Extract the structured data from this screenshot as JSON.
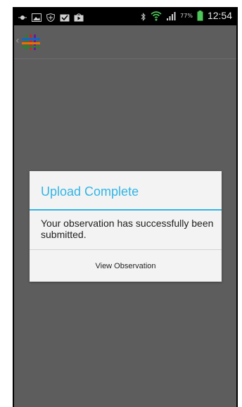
{
  "status_bar": {
    "time": "12:54",
    "battery_percent": "77%",
    "icons": [
      "notification-dot-icon",
      "image-icon",
      "shield-icon",
      "check-box-icon",
      "play-store-icon",
      "bluetooth-icon",
      "wifi-icon",
      "signal-icon",
      "battery-icon"
    ]
  },
  "action_bar": {
    "logo_icon": "app-logo-icon"
  },
  "dialog": {
    "title": "Upload Complete",
    "message": "Your observation has successfully been submitted.",
    "button_label": "View Observation",
    "accent_color": "#33b5e5"
  }
}
